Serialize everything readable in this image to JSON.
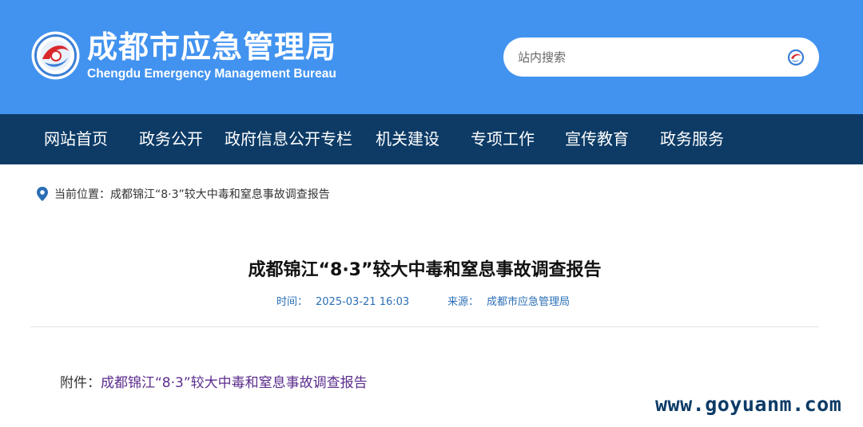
{
  "header": {
    "title_cn": "成都市应急管理局",
    "title_en": "Chengdu Emergency Management Bureau",
    "logo_icon": "bureau-emblem-icon",
    "colors": {
      "header_bg": "#4293f0",
      "nav_bg": "#0d3b66",
      "link_purple": "#5b2d8c",
      "meta_blue": "#2a6fb6"
    }
  },
  "search": {
    "placeholder": "站内搜索",
    "value": "",
    "icon": "search-icon"
  },
  "nav": {
    "items": [
      {
        "label": "网站首页"
      },
      {
        "label": "政务公开"
      },
      {
        "label": "政府信息公开专栏"
      },
      {
        "label": "机关建设"
      },
      {
        "label": "专项工作"
      },
      {
        "label": "宣传教育"
      },
      {
        "label": "政务服务"
      }
    ]
  },
  "breadcrumb": {
    "icon": "location-pin-icon",
    "label": "当前位置：",
    "current": "成都锦江“8·3”较大中毒和窒息事故调查报告"
  },
  "article": {
    "title": "成都锦江“8·3”较大中毒和窒息事故调查报告",
    "time_label": "时间：",
    "time_value": "2025-03-21 16:03",
    "source_label": "来源：",
    "source_value": "成都市应急管理局",
    "attachment_label": "附件：",
    "attachment_link": "成都锦江“8·3”较大中毒和窒息事故调查报告"
  },
  "watermark": {
    "text": "www.goyuanm.com"
  }
}
